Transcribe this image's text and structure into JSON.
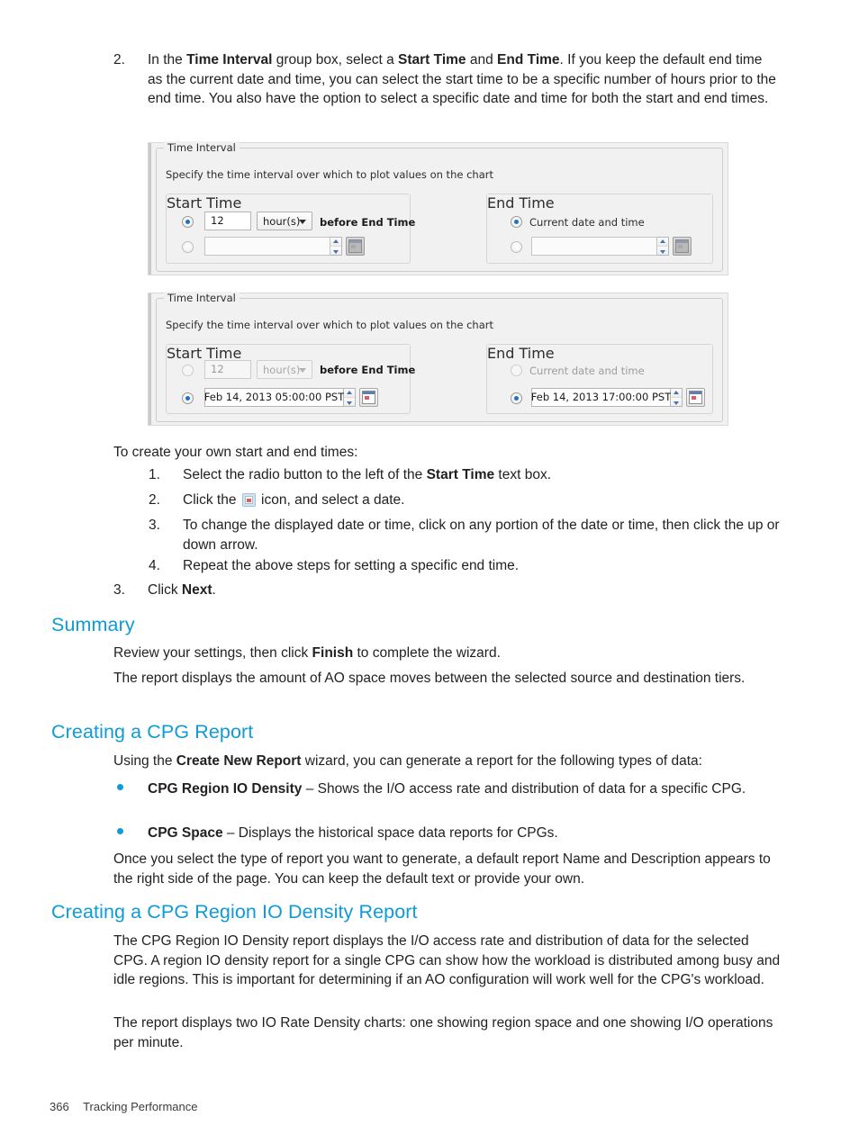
{
  "steps_top": {
    "number": "2.",
    "text_parts": [
      {
        "t": "In the ",
        "b": false
      },
      {
        "t": "Time Interval",
        "b": true
      },
      {
        "t": " group box, select a ",
        "b": false
      },
      {
        "t": "Start Time",
        "b": true
      },
      {
        "t": " and ",
        "b": false
      },
      {
        "t": "End Time",
        "b": true
      },
      {
        "t": ". If you keep the default end time as the current date and time, you can select the start time to be a specific number of hours prior to the end time. You also have the option to select a specific date and time for both the start and end times.",
        "b": false
      }
    ]
  },
  "figure1": {
    "group_title": "Time Interval",
    "caption": "Specify the time interval over which to plot values on the chart",
    "start_time": {
      "title": "Start Time",
      "option1_selected": true,
      "hours_value": "12",
      "unit_value": "hour(s)",
      "suffix_label": "before End Time",
      "option2_selected": false,
      "date_value": ""
    },
    "end_time": {
      "title": "End Time",
      "option1_selected": true,
      "option1_label": "Current date and time",
      "option2_selected": false,
      "date_value": ""
    }
  },
  "figure2": {
    "group_title": "Time Interval",
    "caption": "Specify the time interval over which to plot values on the chart",
    "start_time": {
      "title": "Start Time",
      "option1_selected": false,
      "hours_value": "12",
      "unit_value": "hour(s)",
      "suffix_label": "before End Time",
      "option2_selected": true,
      "date_value": "Feb 14, 2013 05:00:00 PST"
    },
    "end_time": {
      "title": "End Time",
      "option1_selected": false,
      "option1_label": "Current date and time",
      "option2_selected": true,
      "date_value": "Feb 14, 2013 17:00:00 PST"
    }
  },
  "intro_line": "To create your own start and end times:",
  "sub_steps": [
    {
      "number": "1.",
      "parts": [
        {
          "t": "Select the radio button to the left of the ",
          "b": false
        },
        {
          "t": "Start Time",
          "b": true
        },
        {
          "t": " text box.",
          "b": false
        }
      ]
    },
    {
      "number": "2.",
      "parts": [
        {
          "t": "Click the ",
          "b": false
        },
        {
          "t": "calendar-icon",
          "icon": true
        },
        {
          "t": " icon, and select a date.",
          "b": false
        }
      ]
    },
    {
      "number": "3.",
      "parts": [
        {
          "t": "To change the displayed date or time, click on any portion of the date or time, then click the up or down arrow.",
          "b": false
        }
      ]
    },
    {
      "number": "4.",
      "parts": [
        {
          "t": "Repeat the above steps for setting a specific end time.",
          "b": false
        }
      ]
    }
  ],
  "step3": {
    "number": "3.",
    "parts": [
      {
        "t": "Click ",
        "b": false
      },
      {
        "t": "Next",
        "b": true
      },
      {
        "t": ".",
        "b": false
      }
    ]
  },
  "summary": {
    "heading": "Summary",
    "para1_parts": [
      {
        "t": "Review your settings, then click ",
        "b": false
      },
      {
        "t": "Finish",
        "b": true
      },
      {
        "t": " to complete the wizard.",
        "b": false
      }
    ],
    "para2": "The report displays the amount of AO space moves between the selected source and destination tiers."
  },
  "cpg_report": {
    "heading": "Creating a CPG Report",
    "intro_parts": [
      {
        "t": "Using the ",
        "b": false
      },
      {
        "t": "Create New Report",
        "b": true
      },
      {
        "t": " wizard, you can generate a report for the following types of data:",
        "b": false
      }
    ],
    "bullets": [
      {
        "parts": [
          {
            "t": "CPG Region IO Density",
            "b": true
          },
          {
            "t": " – Shows the I/O access rate and distribution of data for a specific CPG.",
            "b": false
          }
        ]
      },
      {
        "parts": [
          {
            "t": "CPG Space",
            "b": true
          },
          {
            "t": " – Displays the historical space data reports for CPGs.",
            "b": false
          }
        ]
      }
    ],
    "outro": "Once you select the type of report you want to generate, a default report Name and Description appears to the right side of the page. You can keep the default text or provide your own."
  },
  "cpg_density": {
    "heading": "Creating a CPG Region IO Density Report",
    "para1": "The CPG Region IO Density report displays the I/O access rate and distribution of data for the selected CPG. A region IO density report for a single CPG can show how the workload is distributed among busy and idle regions. This is important for determining if an AO configuration will work well for the CPG's workload.",
    "para2": "The report displays two IO Rate Density charts: one showing region space and one showing I/O operations per minute."
  },
  "footer": {
    "page_number": "366",
    "section_title": "Tracking Performance"
  },
  "colors": {
    "heading_blue": "#0e9bd8",
    "body_text": "#231f20",
    "figure_bg": "#f1f1f1",
    "radio_dot": "#1f6fc4"
  }
}
